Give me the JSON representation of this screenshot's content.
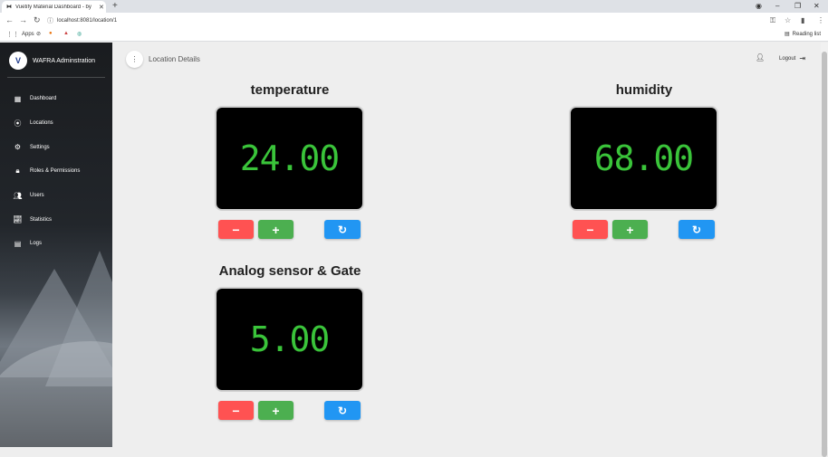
{
  "browser": {
    "tab_title": "Vuetify Material Dashboard - by",
    "tab_close": "✕",
    "new_tab": "+",
    "url": "localhost:8081/location/1",
    "bookmarks": [
      "Apps"
    ],
    "reading_list": "Reading list"
  },
  "sidebar": {
    "brand": "WAFRA Adminstration",
    "items": [
      {
        "label": "Dashboard",
        "icon": "dashboard-icon"
      },
      {
        "label": "Locations",
        "icon": "location-pin-icon"
      },
      {
        "label": "Settings",
        "icon": "gear-icon"
      },
      {
        "label": "Roles & Permissions",
        "icon": "lock-icon"
      },
      {
        "label": "Users",
        "icon": "users-icon"
      },
      {
        "label": "Statistics",
        "icon": "chart-icon"
      },
      {
        "label": "Logs",
        "icon": "logs-icon"
      }
    ]
  },
  "appbar": {
    "title": "Location Details",
    "logout": "Logout"
  },
  "panels": [
    {
      "title": "temperature",
      "value": "24.00"
    },
    {
      "title": "humidity",
      "value": "68.00"
    },
    {
      "title": "Analog sensor & Gate",
      "value": "5.00"
    }
  ],
  "buttons": {
    "minus": "−",
    "plus": "+",
    "reset": "↻"
  },
  "colors": {
    "display_digits": "#3ac43a",
    "minus": "#ff5252",
    "plus": "#4caf50",
    "reset": "#2196f3"
  }
}
